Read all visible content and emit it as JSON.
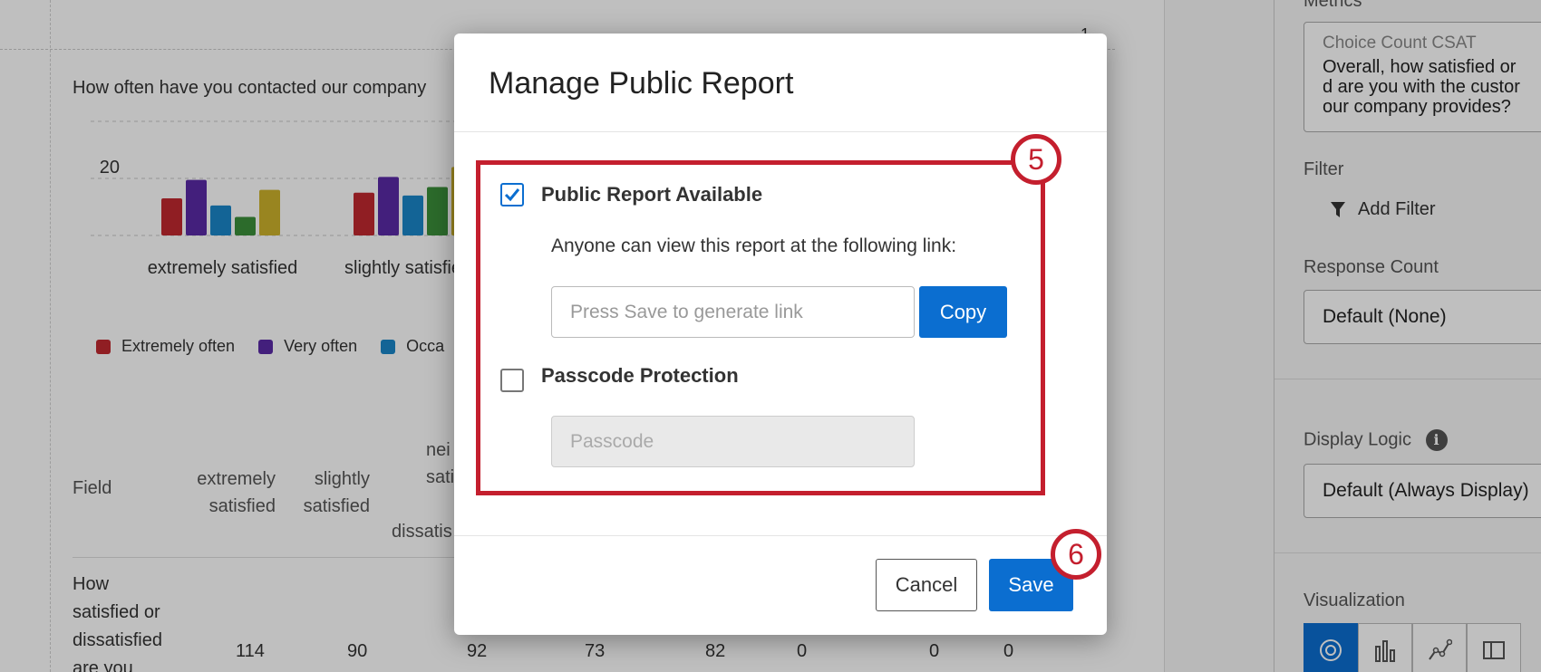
{
  "report": {
    "page_number": "1",
    "question_title": "How often have you contacted our company",
    "legend": [
      {
        "label": "Extremely often",
        "color": "#c0282f"
      },
      {
        "label": "Very often",
        "color": "#5a2aa6"
      },
      {
        "label": "Occa",
        "color": "#1a86c8"
      }
    ],
    "table": {
      "headers": {
        "field": "Field",
        "col1": [
          "extremely",
          "satisfied"
        ],
        "col2": [
          "slightly",
          "satisfied"
        ],
        "col3_top": "nei",
        "col3_mid": "satis",
        "col3_bottom": "dissatis"
      },
      "row_label": [
        "How",
        "satisfied or",
        "dissatisfied",
        "are you"
      ],
      "values": [
        "114",
        "90",
        "92",
        "73",
        "82",
        "0",
        "0",
        "0"
      ]
    }
  },
  "chart_data": {
    "type": "bar",
    "categories": [
      "extremely satisfied",
      "slightly satisfie"
    ],
    "ylim": [
      0,
      40
    ],
    "yticks": [
      "20",
      "40"
    ],
    "series": [
      {
        "name": "Extremely often",
        "color": "#c0282f",
        "values": [
          13,
          15
        ]
      },
      {
        "name": "Very often",
        "color": "#5a2aa6",
        "values": [
          19.5,
          20.5
        ]
      },
      {
        "name": "Occa",
        "color": "#1a86c8",
        "values": [
          10.5,
          14
        ]
      },
      {
        "color": "#3b8f3a",
        "values": [
          6.5,
          17
        ]
      },
      {
        "color": "#cdb22b",
        "values": [
          16,
          24
        ]
      }
    ]
  },
  "side_panel": {
    "metrics_label": "Metrics",
    "metrics_sub": "Choice Count CSAT",
    "metrics_text": "Overall, how satisfied or dissatisfied are you with the customer service our company provides?",
    "metrics_text_lines": [
      "Overall, how satisfied or",
      "d are you with the custor",
      "our company provides?"
    ],
    "filter_label": "Filter",
    "add_filter": "Add Filter",
    "response_count_label": "Response Count",
    "response_count_value": "Default (None)",
    "display_logic_label": "Display Logic",
    "display_logic_value": "Default (Always Display)",
    "visualization_label": "Visualization"
  },
  "modal": {
    "title": "Manage Public Report",
    "public_report_label": "Public Report Available",
    "public_report_checked": true,
    "help_text": "Anyone can view this report at the following link:",
    "link_placeholder": "Press Save to generate link",
    "copy_label": "Copy",
    "passcode_label": "Passcode Protection",
    "passcode_checked": false,
    "passcode_placeholder": "Passcode",
    "cancel_label": "Cancel",
    "save_label": "Save",
    "step_5": "5",
    "step_6": "6",
    "highlight_color": "#c41f2e",
    "accent_color": "#0b6ed0"
  }
}
